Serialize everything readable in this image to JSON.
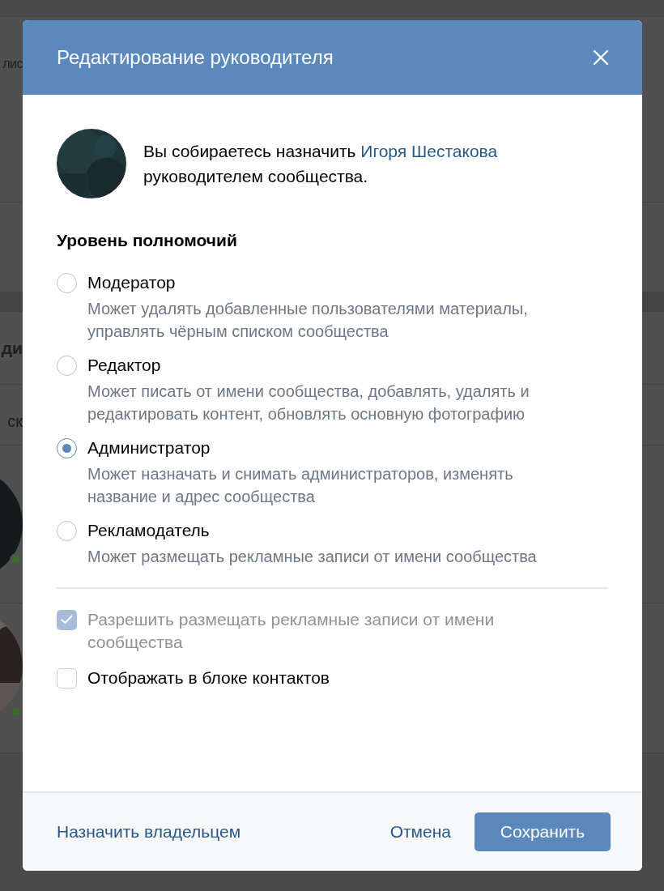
{
  "background": {
    "fragments": [
      "лис",
      "ди",
      "ск"
    ]
  },
  "dialog": {
    "title": "Редактирование руководителя",
    "intro": {
      "before": "Вы собираетесь назначить",
      "link": "Игоря Шестакова",
      "after": "руководителем сообщества."
    },
    "section_title": "Уровень полномочий",
    "roles": [
      {
        "label": "Модератор",
        "description": "Может удалять добавленные пользователями материалы, управлять чёрным списком сообщества",
        "selected": false
      },
      {
        "label": "Редактор",
        "description": "Может писать от имени сообщества, добавлять, удалять и редактировать контент, обновлять основную фотографию",
        "selected": false
      },
      {
        "label": "Администратор",
        "description": "Может назначать и снимать администраторов, изменять название и адрес сообщества",
        "selected": true
      },
      {
        "label": "Рекламодатель",
        "description": "Может размещать рекламные записи от имени сообщества",
        "selected": false
      }
    ],
    "options": [
      {
        "label": "Разрешить размещать рекламные записи от имени сообщества",
        "checked": true,
        "disabled": true
      },
      {
        "label": "Отображать в блоке контактов",
        "checked": false,
        "disabled": false
      }
    ],
    "footer": {
      "owner_link": "Назначить владельцем",
      "cancel": "Отмена",
      "save": "Сохранить"
    }
  }
}
